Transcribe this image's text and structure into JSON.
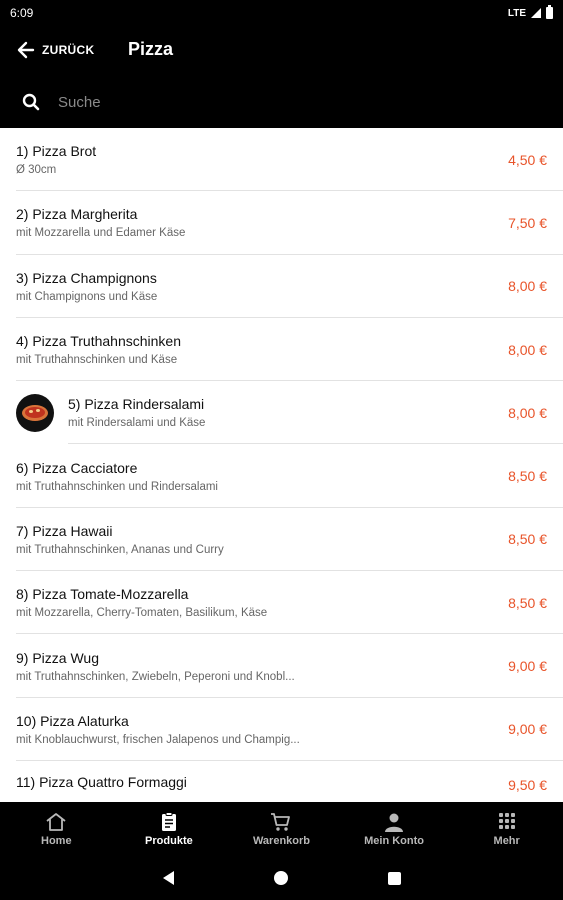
{
  "status_bar": {
    "time": "6:09",
    "network": "LTE"
  },
  "app_bar": {
    "back_label": "ZURÜCK",
    "title": "Pizza"
  },
  "search": {
    "placeholder": "Suche"
  },
  "items": [
    {
      "name": "1) Pizza Brot",
      "description": "Ø 30cm",
      "price": "4,50 €"
    },
    {
      "name": "2) Pizza Margherita",
      "description": "mit Mozzarella und Edamer Käse",
      "price": "7,50 €"
    },
    {
      "name": "3) Pizza Champignons",
      "description": "mit Champignons und Käse",
      "price": "8,00 €"
    },
    {
      "name": "4) Pizza Truthahnschinken",
      "description": "mit Truthahnschinken und Käse",
      "price": "8,00 €"
    },
    {
      "name": "5) Pizza Rindersalami",
      "description": "mit Rindersalami und Käse",
      "price": "8,00 €"
    },
    {
      "name": "6) Pizza Cacciatore",
      "description": "mit Truthahnschinken und Rindersalami",
      "price": "8,50 €"
    },
    {
      "name": "7) Pizza Hawaii",
      "description": "mit Truthahnschinken, Ananas und Curry",
      "price": "8,50 €"
    },
    {
      "name": "8) Pizza Tomate-Mozzarella",
      "description": "mit Mozzarella, Cherry-Tomaten, Basilikum, Käse",
      "price": "8,50 €"
    },
    {
      "name": "9) Pizza Wug",
      "description": "mit Truthahnschinken, Zwiebeln, Peperoni und Knobl...",
      "price": "9,00 €"
    },
    {
      "name": "10) Pizza Alaturka",
      "description": "mit Knoblauchwurst, frischen Jalapenos und Champig...",
      "price": "9,00 €"
    },
    {
      "name": "11) Pizza Quattro Formaggi",
      "description": "",
      "price": "9,50 €"
    }
  ],
  "bottom_nav": [
    {
      "label": "Home",
      "icon": "home-icon"
    },
    {
      "label": "Produkte",
      "icon": "clipboard-icon"
    },
    {
      "label": "Warenkorb",
      "icon": "cart-icon"
    },
    {
      "label": "Mein Konto",
      "icon": "user-icon"
    },
    {
      "label": "Mehr",
      "icon": "grid-icon"
    }
  ],
  "colors": {
    "price": "#e8542a",
    "bar_background": "#000000",
    "active_nav": "#ffffff",
    "inactive_nav": "#b8b8b8"
  }
}
